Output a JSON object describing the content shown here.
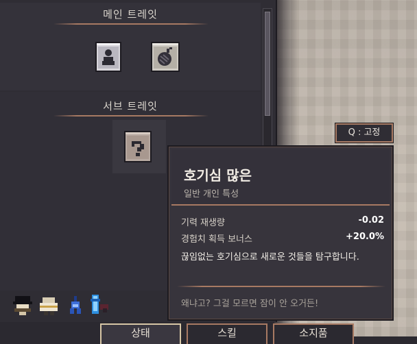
{
  "traits_panel": {
    "main_title": "메인 트레잇",
    "sub_title": "서브 트레잇",
    "main_traits": [
      "person-trait-icon",
      "bomb-trait-icon"
    ],
    "sub_traits": [
      "question-mark-trait-icon"
    ]
  },
  "fix_hint": "Q : 고정",
  "tooltip": {
    "title": "호기심 많은",
    "subtitle": "일반 개인 특성",
    "stats": [
      {
        "label": "기력 재생량",
        "value": "-0.02"
      },
      {
        "label": "경험치 획득 보너스",
        "value": "+20.0%"
      }
    ],
    "description": "끊임없는 호기심으로 새로운 것들을 탐구합니다.",
    "quote": "왜냐고? 그걸 모르면 잠이 안 오거든!"
  },
  "status_icons": [
    "mustache-hat-icon",
    "wrapped-bundle-icon",
    "blue-figure-icon",
    "blue-potion-icon"
  ],
  "tabs": [
    {
      "label": "상태",
      "active": true
    },
    {
      "label": "스킬",
      "active": false
    },
    {
      "label": "소지품",
      "active": false
    }
  ],
  "colors": {
    "accent": "#a87a63",
    "panel": "#2f2d34",
    "floor": "#c2b9ae"
  }
}
